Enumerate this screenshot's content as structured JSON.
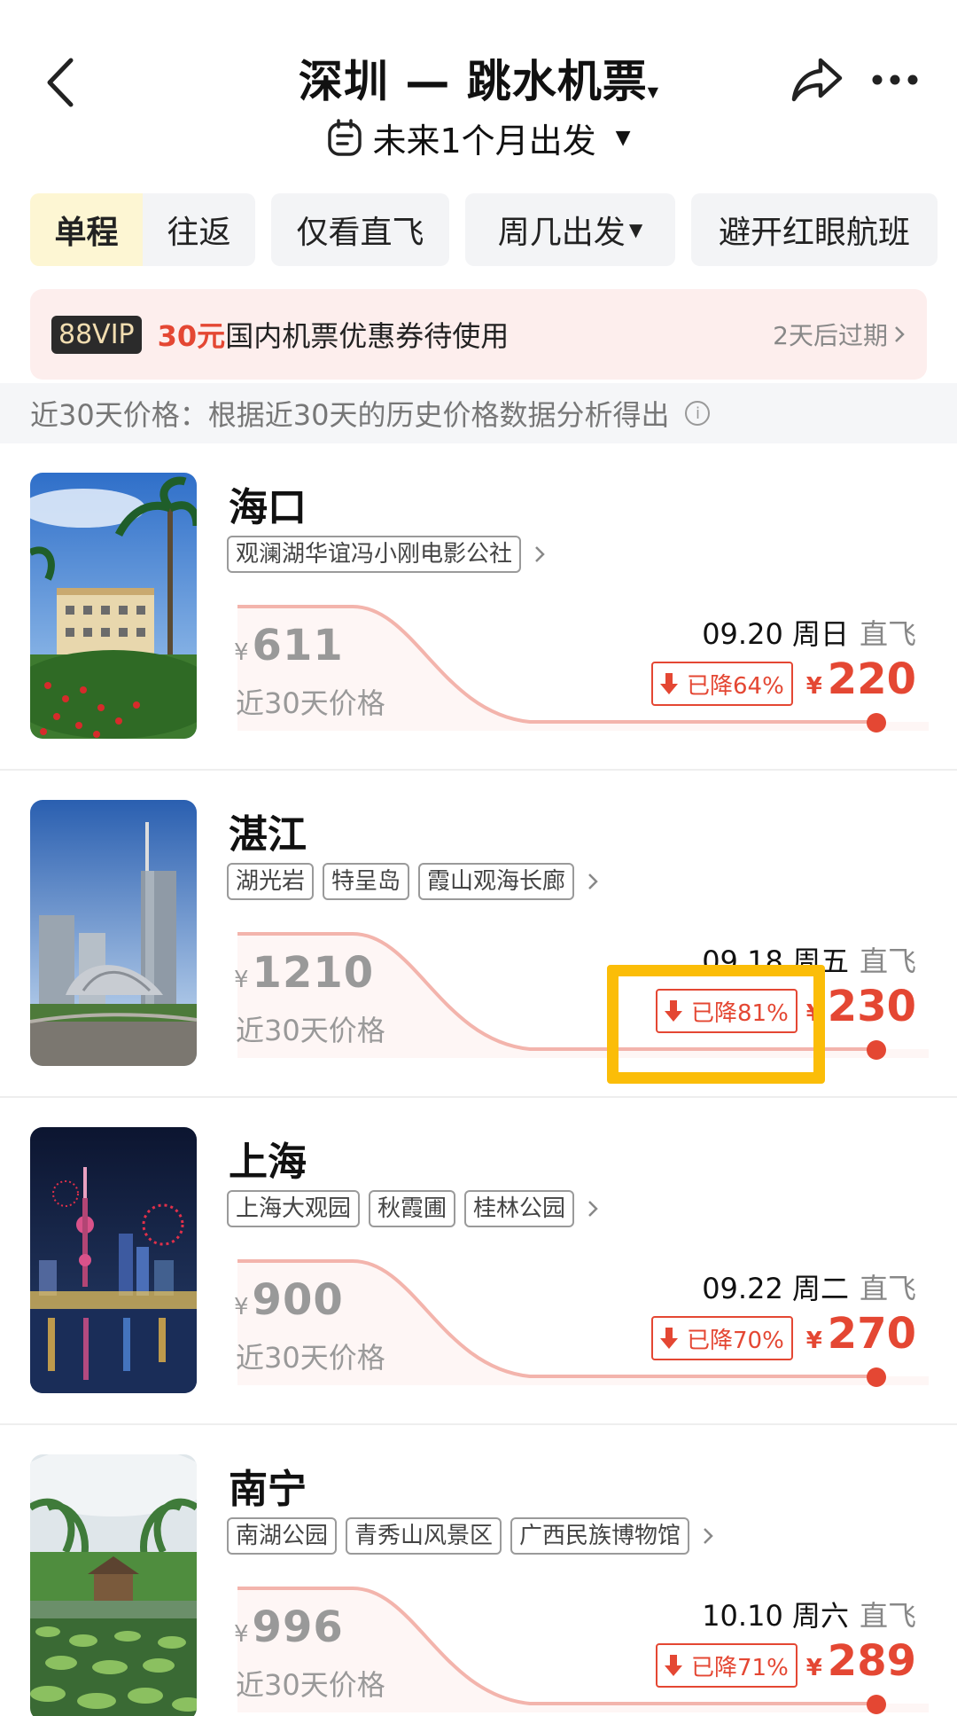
{
  "header": {
    "title": "深圳 — 跳水机票",
    "subtitle": "未来1个月出发"
  },
  "filters": {
    "segment": [
      {
        "label": "单程",
        "active": true
      },
      {
        "label": "往返",
        "active": false
      }
    ],
    "chips": [
      "仅看直飞",
      "周几出发",
      "避开红眼航班"
    ]
  },
  "coupon": {
    "vip": "88VIP",
    "amount": "30元",
    "text": "国内机票优惠券待使用",
    "expire": "2天后过期"
  },
  "info": {
    "text": "近30天价格：根据近30天的历史价格数据分析得出"
  },
  "cards": [
    {
      "city": "海口",
      "tags": [
        "观澜湖华谊冯小刚电影公社"
      ],
      "currency": "¥",
      "old_price": "611",
      "old_label": "近30天价格",
      "date": "09.20 周日",
      "direct": "直飞",
      "drop": "已降64%",
      "new_price": "220"
    },
    {
      "city": "湛江",
      "tags": [
        "湖光岩",
        "特呈岛",
        "霞山观海长廊"
      ],
      "currency": "¥",
      "old_price": "1210",
      "old_label": "近30天价格",
      "date": "09.18 周五",
      "direct": "直飞",
      "drop": "已降81%",
      "new_price": "230"
    },
    {
      "city": "上海",
      "tags": [
        "上海大观园",
        "秋霞圃",
        "桂林公园"
      ],
      "currency": "¥",
      "old_price": "900",
      "old_label": "近30天价格",
      "date": "09.22 周二",
      "direct": "直飞",
      "drop": "已降70%",
      "new_price": "270"
    },
    {
      "city": "南宁",
      "tags": [
        "南湖公园",
        "青秀山风景区",
        "广西民族博物馆"
      ],
      "currency": "¥",
      "old_price": "996",
      "old_label": "近30天价格",
      "date": "10.10 周六",
      "direct": "直飞",
      "drop": "已降71%",
      "new_price": "289"
    }
  ],
  "colors": {
    "accent": "#e44733",
    "highlight": "#fbbd08",
    "active_segment": "#fdf6d3"
  },
  "icons": [
    "back-icon",
    "share-icon",
    "more-icon",
    "clock-icon",
    "info-icon",
    "down-arrow-icon",
    "chevron-right-icon"
  ]
}
